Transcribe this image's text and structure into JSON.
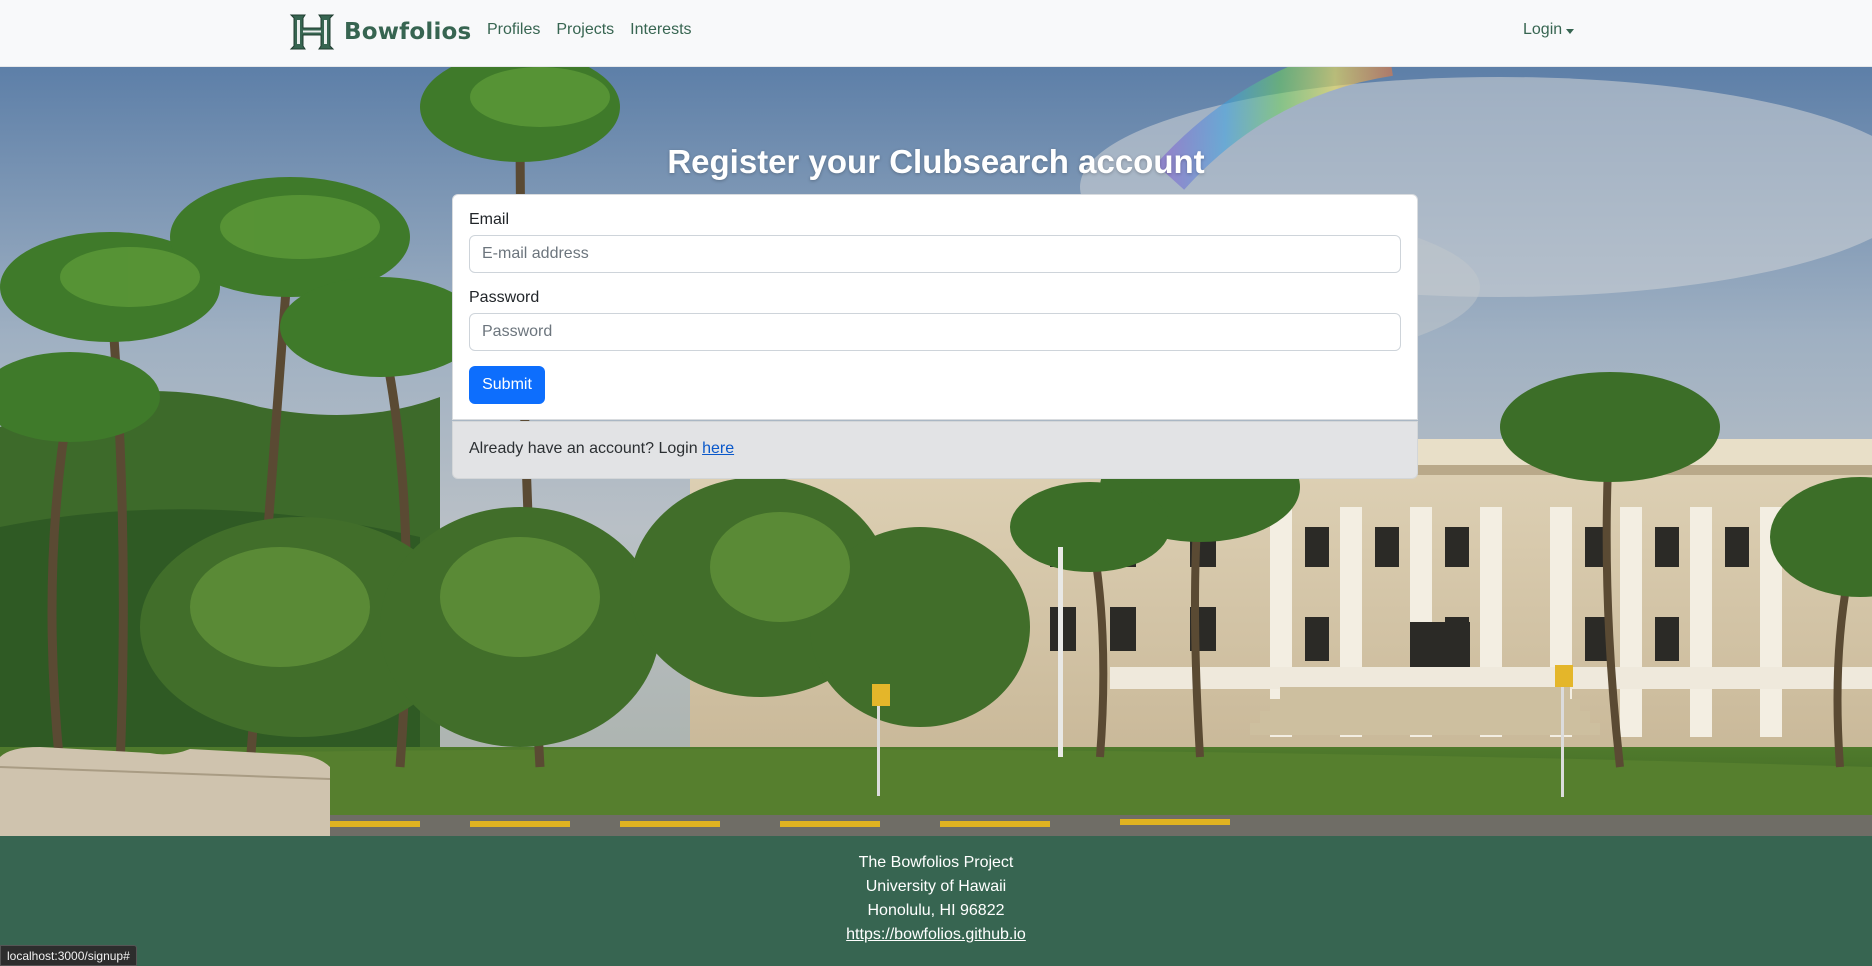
{
  "navbar": {
    "brand": "Bowfolios",
    "links": [
      "Profiles",
      "Projects",
      "Interests"
    ],
    "login_label": "Login",
    "brand_color": "#376551"
  },
  "register": {
    "heading": "Register your Clubsearch account",
    "email_label": "Email",
    "email_placeholder": "E-mail address",
    "email_value": "",
    "password_label": "Password",
    "password_placeholder": "Password",
    "password_value": "",
    "submit_label": "Submit",
    "submit_color": "#0d6efd",
    "login_prompt": "Already have an account? Login ",
    "login_link": "here"
  },
  "footer": {
    "lines": [
      "The Bowfolios Project",
      "University of Hawaii",
      "Honolulu, HI 96822"
    ],
    "link": "https://bowfolios.github.io",
    "background": "#376551"
  },
  "status_bar": {
    "url": "localhost:3000/signup#"
  }
}
